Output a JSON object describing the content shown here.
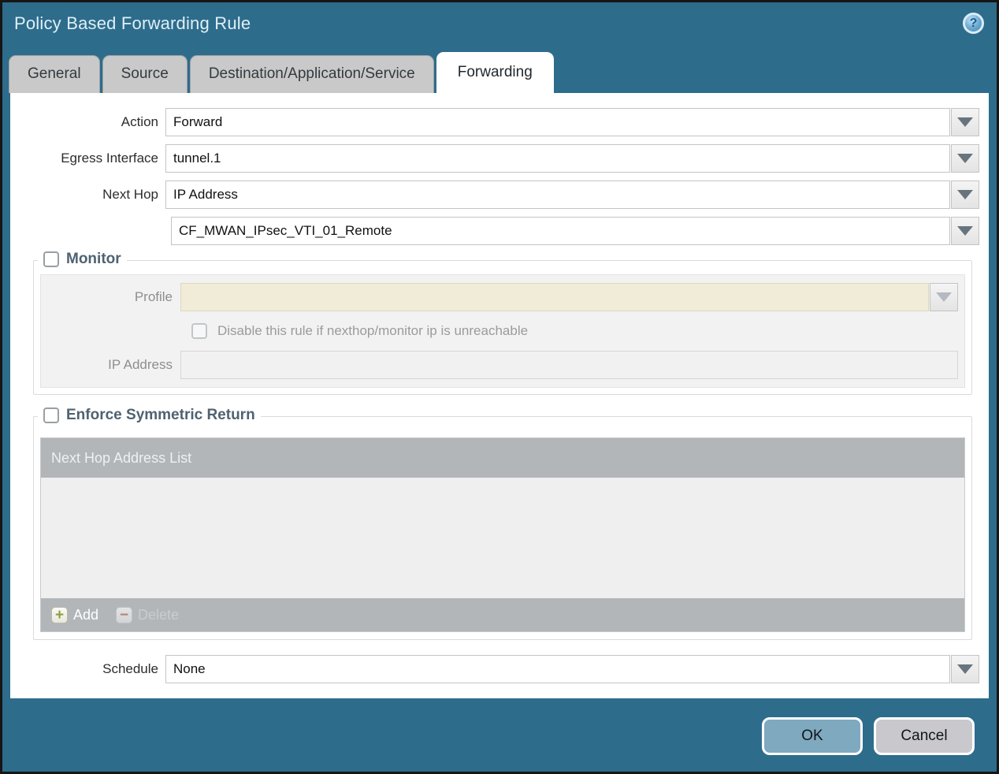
{
  "window": {
    "title": "Policy Based Forwarding Rule",
    "help_icon": "?"
  },
  "tabs": [
    {
      "label": "General",
      "active": false
    },
    {
      "label": "Source",
      "active": false
    },
    {
      "label": "Destination/Application/Service",
      "active": false
    },
    {
      "label": "Forwarding",
      "active": true
    }
  ],
  "form": {
    "action_label": "Action",
    "action_value": "Forward",
    "egress_label": "Egress Interface",
    "egress_value": "tunnel.1",
    "next_hop_label": "Next Hop",
    "next_hop_value": "IP Address",
    "next_hop_address_value": "CF_MWAN_IPsec_VTI_01_Remote",
    "schedule_label": "Schedule",
    "schedule_value": "None"
  },
  "monitor": {
    "title": "Monitor",
    "checked": false,
    "profile_label": "Profile",
    "profile_value": "",
    "disable_label": "Disable this rule if nexthop/monitor ip is unreachable",
    "disable_checked": false,
    "ip_label": "IP Address",
    "ip_value": ""
  },
  "enforce": {
    "title": "Enforce Symmetric Return",
    "checked": false,
    "list_header": "Next Hop Address List",
    "rows": [],
    "add_label": "Add",
    "add_icon": "+",
    "delete_label": "Delete",
    "delete_icon": "−"
  },
  "buttons": {
    "ok": "OK",
    "cancel": "Cancel"
  },
  "colors": {
    "frame": "#2e6c8c",
    "title_text": "#dff0f6",
    "tab_inactive": "#c9c9c9",
    "section_title": "#4e6271",
    "table_chrome": "#b2b6b9",
    "profile_field_bg": "#f1ecd8",
    "ok_button": "#7fa9bf",
    "cancel_button": "#c9c9cd",
    "add_plus": "#8ba03a",
    "delete_minus": "#b5836f"
  }
}
